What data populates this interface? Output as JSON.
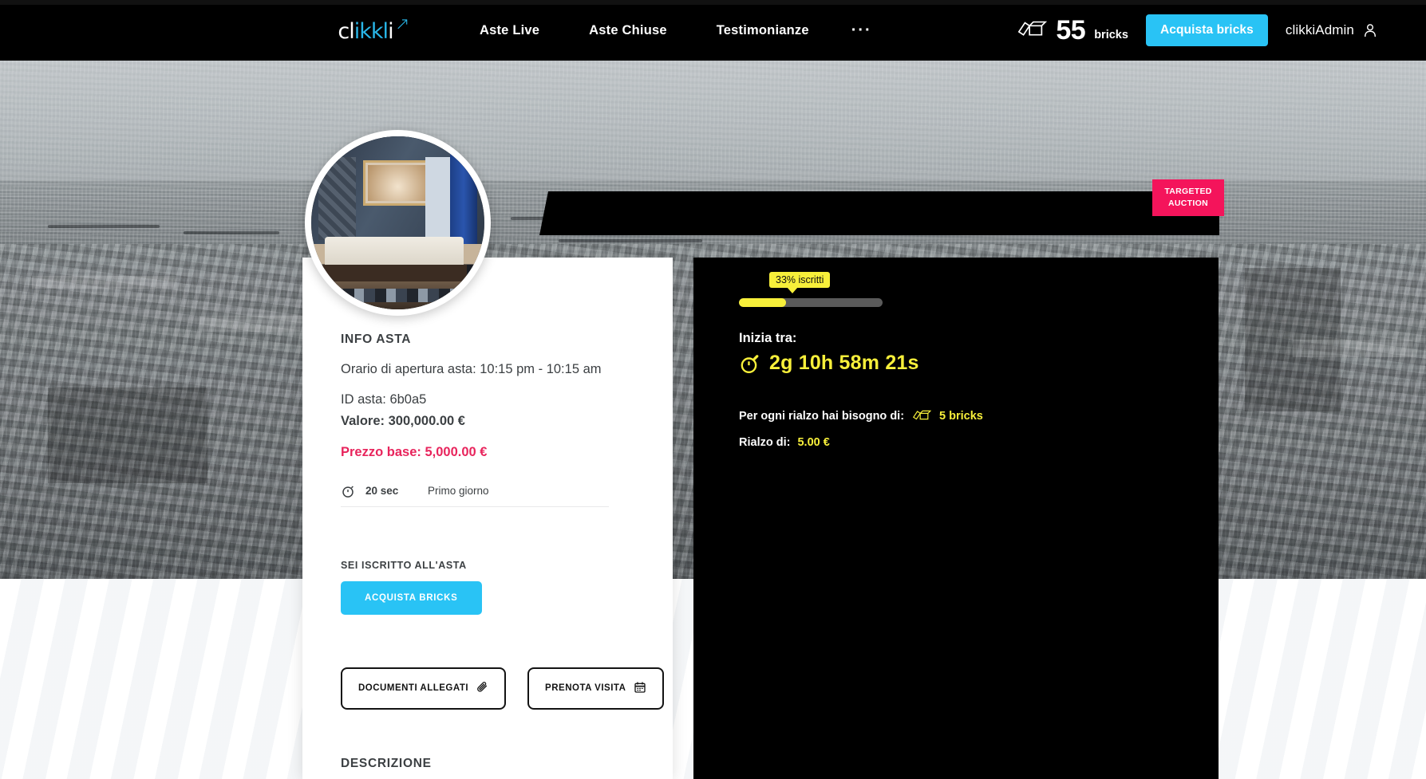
{
  "nav": {
    "logo_text": "clikkli",
    "logo_icon": "clikkli-logo",
    "links": [
      {
        "label": "Aste Live"
      },
      {
        "label": "Aste Chiuse"
      },
      {
        "label": "Testimonianze"
      }
    ],
    "more_label": "···",
    "bricks_icon": "bricks-icon",
    "bricks_count": "55",
    "bricks_unit": "bricks",
    "buy_bricks_label": "Acquista bricks",
    "user_name": "clikkiAdmin",
    "user_icon": "user-icon"
  },
  "badge": {
    "line1": "TARGETED",
    "line2": "AUCTION",
    "color": "#f4145b"
  },
  "title_band": {
    "text": ""
  },
  "info_card": {
    "section_title": "INFO ASTA",
    "opening_hours": "Orario di apertura asta: 10:15 pm - 10:15 am",
    "auction_id": "ID asta: 6b0a5",
    "valore_label": "Valore:",
    "valore_value": "300,000.00 €",
    "prezzo_base_label": "Prezzo base:",
    "prezzo_base_value": "5,000.00 €",
    "prezzo_base_color": "#e8245c",
    "timeline": {
      "clock_icon": "stopwatch-icon",
      "duration": "20 sec",
      "day_label": "Primo giorno"
    },
    "subscribed_label": "SEI ISCRITTO ALL'ASTA",
    "acquista_bricks_label": "ACQUISTA BRICKS",
    "documents_button": "DOCUMENTI ALLEGATI",
    "documents_icon": "paperclip-icon",
    "visit_button": "PRENOTA VISITA",
    "visit_icon": "calendar-icon",
    "description_title": "DESCRIZIONE"
  },
  "auction_panel": {
    "progress_tooltip": "33% iscritti",
    "progress_percent": 33,
    "progress_fill_color": "#f7ef3a",
    "progress_track_color": "#5a5a5a",
    "starts_in_label": "Inizia tra:",
    "countdown_icon": "stopwatch-icon",
    "countdown": "2g 10h 58m 21s",
    "raise_need_label": "Per ogni rialzo hai bisogno di:",
    "raise_need_icon": "bricks-icon",
    "raise_need_value": "5 bricks",
    "raise_label": "Rialzo di:",
    "raise_value": "5.00 €",
    "accent_color": "#f7ef3a"
  }
}
